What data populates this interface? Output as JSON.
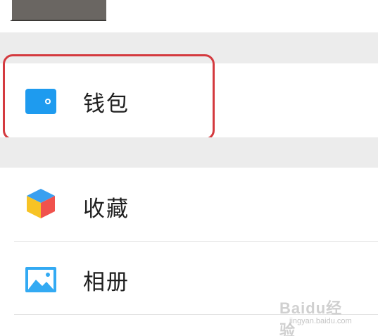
{
  "menu": {
    "items": [
      {
        "label": "钱包",
        "icon": "wallet-icon"
      },
      {
        "label": "收藏",
        "icon": "favorites-cube-icon"
      },
      {
        "label": "相册",
        "icon": "album-icon"
      }
    ]
  },
  "watermark": {
    "brand": "Bai",
    "brand_symbol": "du",
    "subtext": "jingyan.baidu.com",
    "brand_cn": "经验"
  },
  "colors": {
    "highlight": "#d43a3f",
    "wallet_icon": "#1e9bef",
    "album_icon": "#33aaf3",
    "section_gap": "#ececec"
  }
}
